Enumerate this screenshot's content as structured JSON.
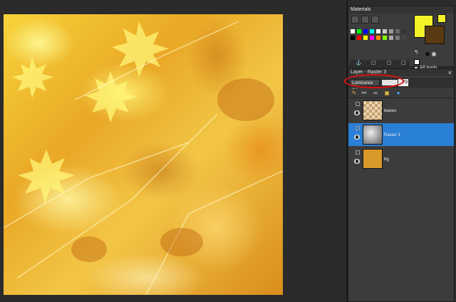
{
  "materials": {
    "title": "Materials",
    "all_tools_label": "All tools",
    "fg_color": "#f5f22a",
    "bg_color": "#5a3a10",
    "palette": [
      "#ffffff",
      "#00ff00",
      "#0000ff",
      "#00ffff",
      "#ffffff",
      "#cccccc",
      "#999999",
      "#666666",
      "#333333",
      "#000000",
      "#ff0000",
      "#ffff00",
      "#ff00ff",
      "#ff8800",
      "#88ff00",
      "#aaaaaa",
      "#777777",
      "#444444"
    ]
  },
  "layers": {
    "title": "Layer - Raster 3",
    "close_icon": "×",
    "blend_mode": "Luminance (L)",
    "opacity": "79",
    "items": [
      {
        "name": "leaves",
        "selected": false
      },
      {
        "name": "Raster 3",
        "selected": true
      },
      {
        "name": "bg",
        "selected": false
      }
    ]
  },
  "canvas": {
    "description_icon": "autumn-leaves-image"
  }
}
